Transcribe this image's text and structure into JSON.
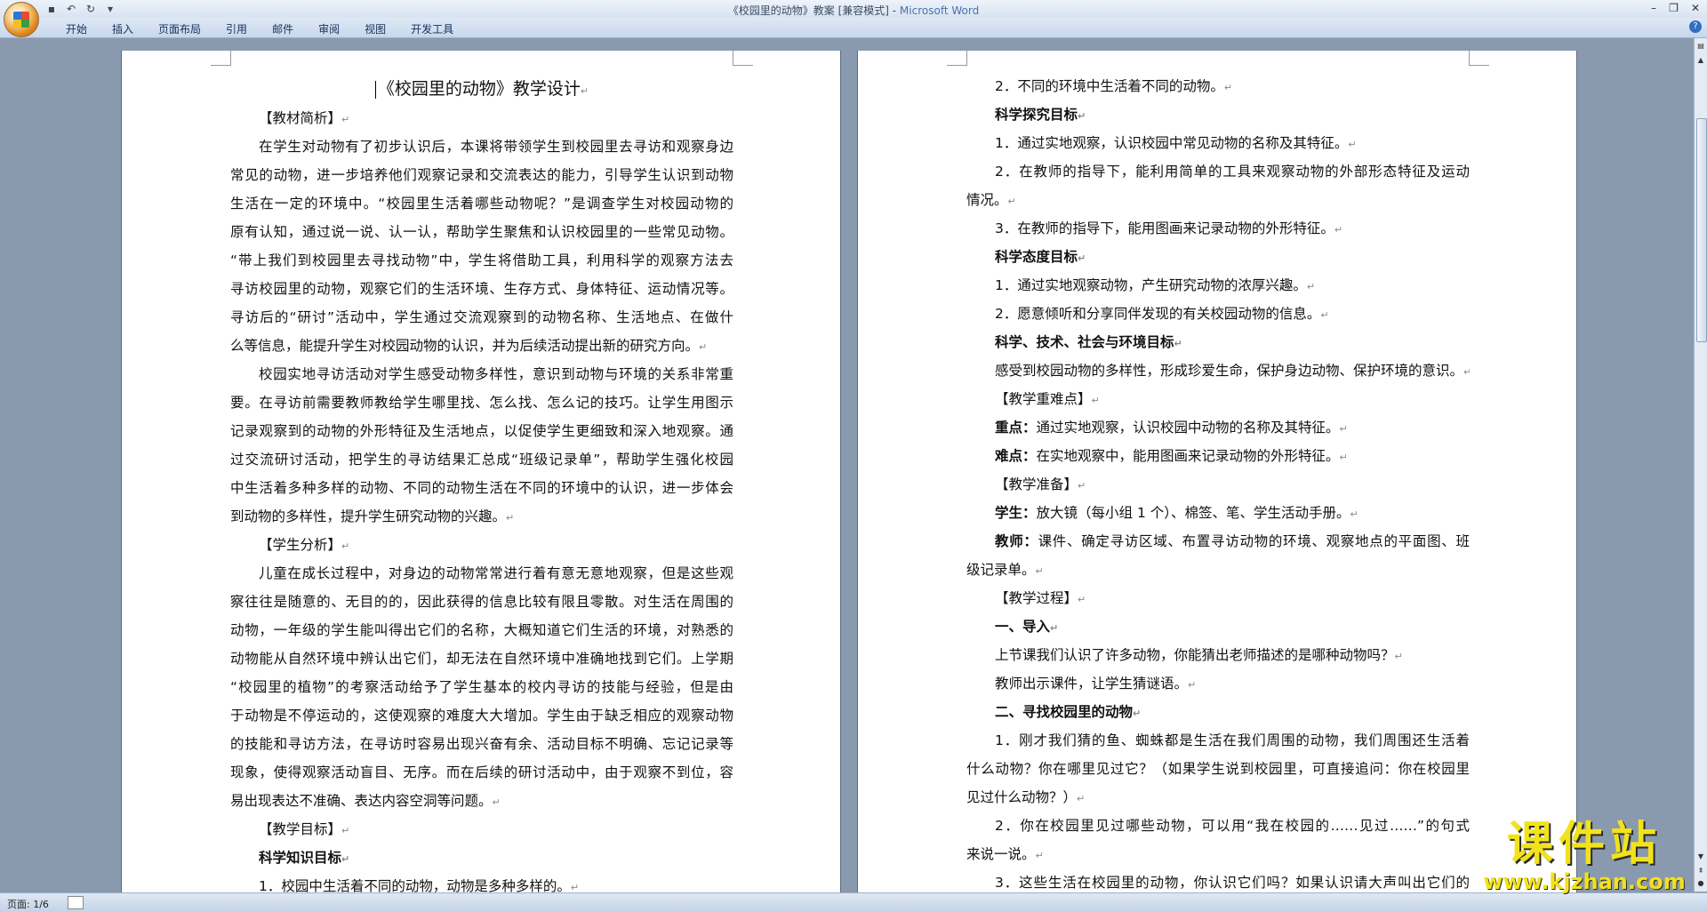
{
  "window": {
    "title": "《校园里的动物》教案 [兼容模式] - ",
    "app_name": "Microsoft Word"
  },
  "ribbon": {
    "tabs": [
      "开始",
      "插入",
      "页面布局",
      "引用",
      "邮件",
      "审阅",
      "视图",
      "开发工具"
    ]
  },
  "page1": {
    "title": "《校园里的动物》教学设计",
    "lines": [
      {
        "t": "【教材简析】",
        "ind": true,
        "j": false,
        "b": false
      },
      {
        "t": "在学生对动物有了初步认识后，本课将带领学生到校园里去寻访和观察身边",
        "ind": true,
        "j": true,
        "b": false
      },
      {
        "t": "常见的动物，进一步培养他们观察记录和交流表达的能力，引导学生认识到动物",
        "ind": false,
        "j": true,
        "b": false
      },
      {
        "t": "生活在一定的环境中。“校园里生活着哪些动物呢？”是调查学生对校园动物的",
        "ind": false,
        "j": true,
        "b": false
      },
      {
        "t": "原有认知，通过说一说、认一认，帮助学生聚焦和认识校园里的一些常见动物。",
        "ind": false,
        "j": true,
        "b": false
      },
      {
        "t": "“带上我们到校园里去寻找动物”中，学生将借助工具，利用科学的观察方法去",
        "ind": false,
        "j": true,
        "b": false
      },
      {
        "t": "寻访校园里的动物，观察它们的生活环境、生存方式、身体特征、运动情况等。",
        "ind": false,
        "j": true,
        "b": false
      },
      {
        "t": "寻访后的“研讨”活动中，学生通过交流观察到的动物名称、生活地点、在做什",
        "ind": false,
        "j": true,
        "b": false
      },
      {
        "t": "么等信息，能提升学生对校园动物的认识，并为后续活动提出新的研究方向。",
        "ind": false,
        "j": false,
        "b": false
      },
      {
        "t": "校园实地寻访活动对学生感受动物多样性，意识到动物与环境的关系非常重",
        "ind": true,
        "j": true,
        "b": false
      },
      {
        "t": "要。在寻访前需要教师教给学生哪里找、怎么找、怎么记的技巧。让学生用图示",
        "ind": false,
        "j": true,
        "b": false
      },
      {
        "t": "记录观察到的动物的外形特征及生活地点，以促使学生更细致和深入地观察。通",
        "ind": false,
        "j": true,
        "b": false
      },
      {
        "t": "过交流研讨活动，把学生的寻访结果汇总成“班级记录单”，帮助学生强化校园",
        "ind": false,
        "j": true,
        "b": false
      },
      {
        "t": "中生活着多种多样的动物、不同的动物生活在不同的环境中的认识，进一步体会",
        "ind": false,
        "j": true,
        "b": false
      },
      {
        "t": "到动物的多样性，提升学生研究动物的兴趣。",
        "ind": false,
        "j": false,
        "b": false
      },
      {
        "t": "【学生分析】",
        "ind": true,
        "j": false,
        "b": false
      },
      {
        "t": "儿童在成长过程中，对身边的动物常常进行着有意无意地观察，但是这些观",
        "ind": true,
        "j": true,
        "b": false
      },
      {
        "t": "察往往是随意的、无目的的，因此获得的信息比较有限且零散。对生活在周围的",
        "ind": false,
        "j": true,
        "b": false
      },
      {
        "t": "动物，一年级的学生能叫得出它们的名称，大概知道它们生活的环境，对熟悉的",
        "ind": false,
        "j": true,
        "b": false
      },
      {
        "t": "动物能从自然环境中辨认出它们，却无法在自然环境中准确地找到它们。上学期",
        "ind": false,
        "j": true,
        "b": false
      },
      {
        "t": "“校园里的植物”的考察活动给予了学生基本的校内寻访的技能与经验，但是由",
        "ind": false,
        "j": true,
        "b": false
      },
      {
        "t": "于动物是不停运动的，这使观察的难度大大增加。学生由于缺乏相应的观察动物",
        "ind": false,
        "j": true,
        "b": false
      },
      {
        "t": "的技能和寻访方法，在寻访时容易出现兴奋有余、活动目标不明确、忘记记录等",
        "ind": false,
        "j": true,
        "b": false
      },
      {
        "t": "现象，使得观察活动盲目、无序。而在后续的研讨活动中，由于观察不到位，容",
        "ind": false,
        "j": true,
        "b": false
      },
      {
        "t": "易出现表达不准确、表达内容空洞等问题。",
        "ind": false,
        "j": false,
        "b": false
      },
      {
        "t": "【教学目标】",
        "ind": true,
        "j": false,
        "b": false
      },
      {
        "t": "科学知识目标",
        "ind": true,
        "j": false,
        "b": true
      },
      {
        "t": "1．校园中生活着不同的动物，动物是多种多样的。",
        "ind": true,
        "j": false,
        "b": false
      }
    ]
  },
  "page2": {
    "lines": [
      {
        "t": "2．不同的环境中生活着不同的动物。",
        "ind": true,
        "j": false,
        "b": false,
        "lb": ""
      },
      {
        "t": "科学探究目标",
        "ind": true,
        "j": false,
        "b": true,
        "lb": ""
      },
      {
        "t": "1．通过实地观察，认识校园中常见动物的名称及其特征。",
        "ind": true,
        "j": false,
        "b": false,
        "lb": ""
      },
      {
        "t": "2．在教师的指导下，能利用简单的工具来观察动物的外部形态特征及运动",
        "ind": true,
        "j": true,
        "b": false,
        "lb": ""
      },
      {
        "t": "情况。",
        "ind": false,
        "j": false,
        "b": false,
        "lb": ""
      },
      {
        "t": "3．在教师的指导下，能用图画来记录动物的外形特征。",
        "ind": true,
        "j": false,
        "b": false,
        "lb": ""
      },
      {
        "t": "科学态度目标",
        "ind": true,
        "j": false,
        "b": true,
        "lb": ""
      },
      {
        "t": "1．通过实地观察动物，产生研究动物的浓厚兴趣。",
        "ind": true,
        "j": false,
        "b": false,
        "lb": ""
      },
      {
        "t": "2．愿意倾听和分享同伴发现的有关校园动物的信息。",
        "ind": true,
        "j": false,
        "b": false,
        "lb": ""
      },
      {
        "t": "科学、技术、社会与环境目标",
        "ind": true,
        "j": false,
        "b": true,
        "lb": ""
      },
      {
        "t": "感受到校园动物的多样性，形成珍爱生命，保护身边动物、保护环境的意识。",
        "ind": true,
        "j": false,
        "b": false,
        "lb": ""
      },
      {
        "t": "【教学重难点】",
        "ind": true,
        "j": false,
        "b": false,
        "lb": ""
      },
      {
        "t": "通过实地观察，认识校园中动物的名称及其特征。",
        "ind": true,
        "j": false,
        "b": false,
        "lb": "重点："
      },
      {
        "t": "在实地观察中，能用图画来记录动物的外形特征。",
        "ind": true,
        "j": false,
        "b": false,
        "lb": "难点："
      },
      {
        "t": "【教学准备】",
        "ind": true,
        "j": false,
        "b": false,
        "lb": ""
      },
      {
        "t": "放大镜（每小组 1 个）、棉签、笔、学生活动手册。",
        "ind": true,
        "j": false,
        "b": false,
        "lb": "学生："
      },
      {
        "t": "课件、确定寻访区域、布置寻访动物的环境、观察地点的平面图、班",
        "ind": true,
        "j": true,
        "b": false,
        "lb": "教师："
      },
      {
        "t": "级记录单。",
        "ind": false,
        "j": false,
        "b": false,
        "lb": ""
      },
      {
        "t": "【教学过程】",
        "ind": true,
        "j": false,
        "b": false,
        "lb": ""
      },
      {
        "t": "一、导入",
        "ind": true,
        "j": false,
        "b": true,
        "lb": ""
      },
      {
        "t": "上节课我们认识了许多动物，你能猜出老师描述的是哪种动物吗？",
        "ind": true,
        "j": false,
        "b": false,
        "lb": ""
      },
      {
        "t": "教师出示课件，让学生猜谜语。",
        "ind": true,
        "j": false,
        "b": false,
        "lb": ""
      },
      {
        "t": "二、寻找校园里的动物",
        "ind": true,
        "j": false,
        "b": true,
        "lb": ""
      },
      {
        "t": "1．刚才我们猜的鱼、蜘蛛都是生活在我们周围的动物，我们周围还生活着",
        "ind": true,
        "j": true,
        "b": false,
        "lb": ""
      },
      {
        "t": "什么动物？你在哪里见过它？（如果学生说到校园里，可直接追问：你在校园里",
        "ind": false,
        "j": true,
        "b": false,
        "lb": ""
      },
      {
        "t": "见过什么动物？）",
        "ind": false,
        "j": false,
        "b": false,
        "lb": ""
      },
      {
        "t": "2．你在校园里见过哪些动物，可以用“我在校园的……见过……”的句式",
        "ind": true,
        "j": true,
        "b": false,
        "lb": ""
      },
      {
        "t": "来说一说。",
        "ind": false,
        "j": false,
        "b": false,
        "lb": ""
      },
      {
        "t": "3．这些生活在校园里的动物，你认识它们吗？如果认识请大声叫出它们的",
        "ind": true,
        "j": true,
        "b": false,
        "lb": ""
      }
    ]
  },
  "statusbar": {
    "page_info": "页面: 1/6"
  },
  "watermark": {
    "text": "课件站",
    "url": "www.kjzhan.com"
  }
}
